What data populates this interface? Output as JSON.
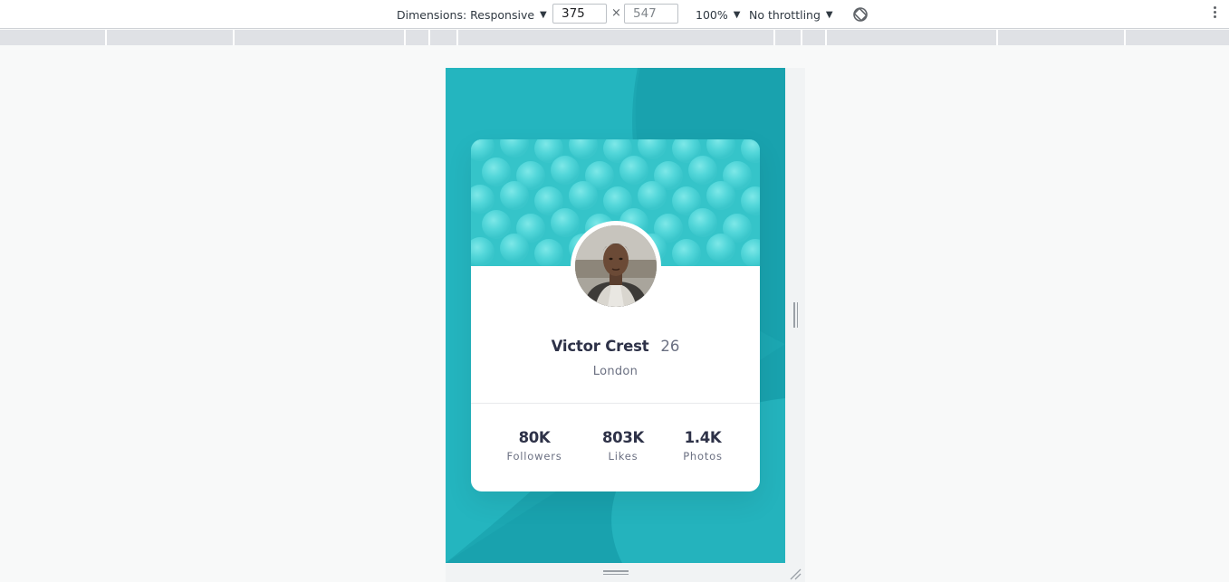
{
  "devtools": {
    "dimensions_label": "Dimensions: Responsive",
    "width_value": "375",
    "height_value": "547",
    "times_symbol": "×",
    "zoom_label": "100%",
    "throttling_label": "No throttling",
    "caret": "▼"
  },
  "profile": {
    "name": "Victor Crest",
    "age": "26",
    "city": "London",
    "stats": [
      {
        "value": "80K",
        "label": "Followers"
      },
      {
        "value": "803K",
        "label": "Likes"
      },
      {
        "value": "1.4K",
        "label": "Photos"
      }
    ]
  },
  "colors": {
    "background_dark": "#19a2ae",
    "background_light": "#2bbec6",
    "banner": "#3bcbcf",
    "text_dark": "#2e3248",
    "text_muted": "#6b7082"
  },
  "icons": {
    "rotate": "screen-rotation-icon",
    "more": "more-vert-icon",
    "resize": "resize-corner-icon"
  }
}
